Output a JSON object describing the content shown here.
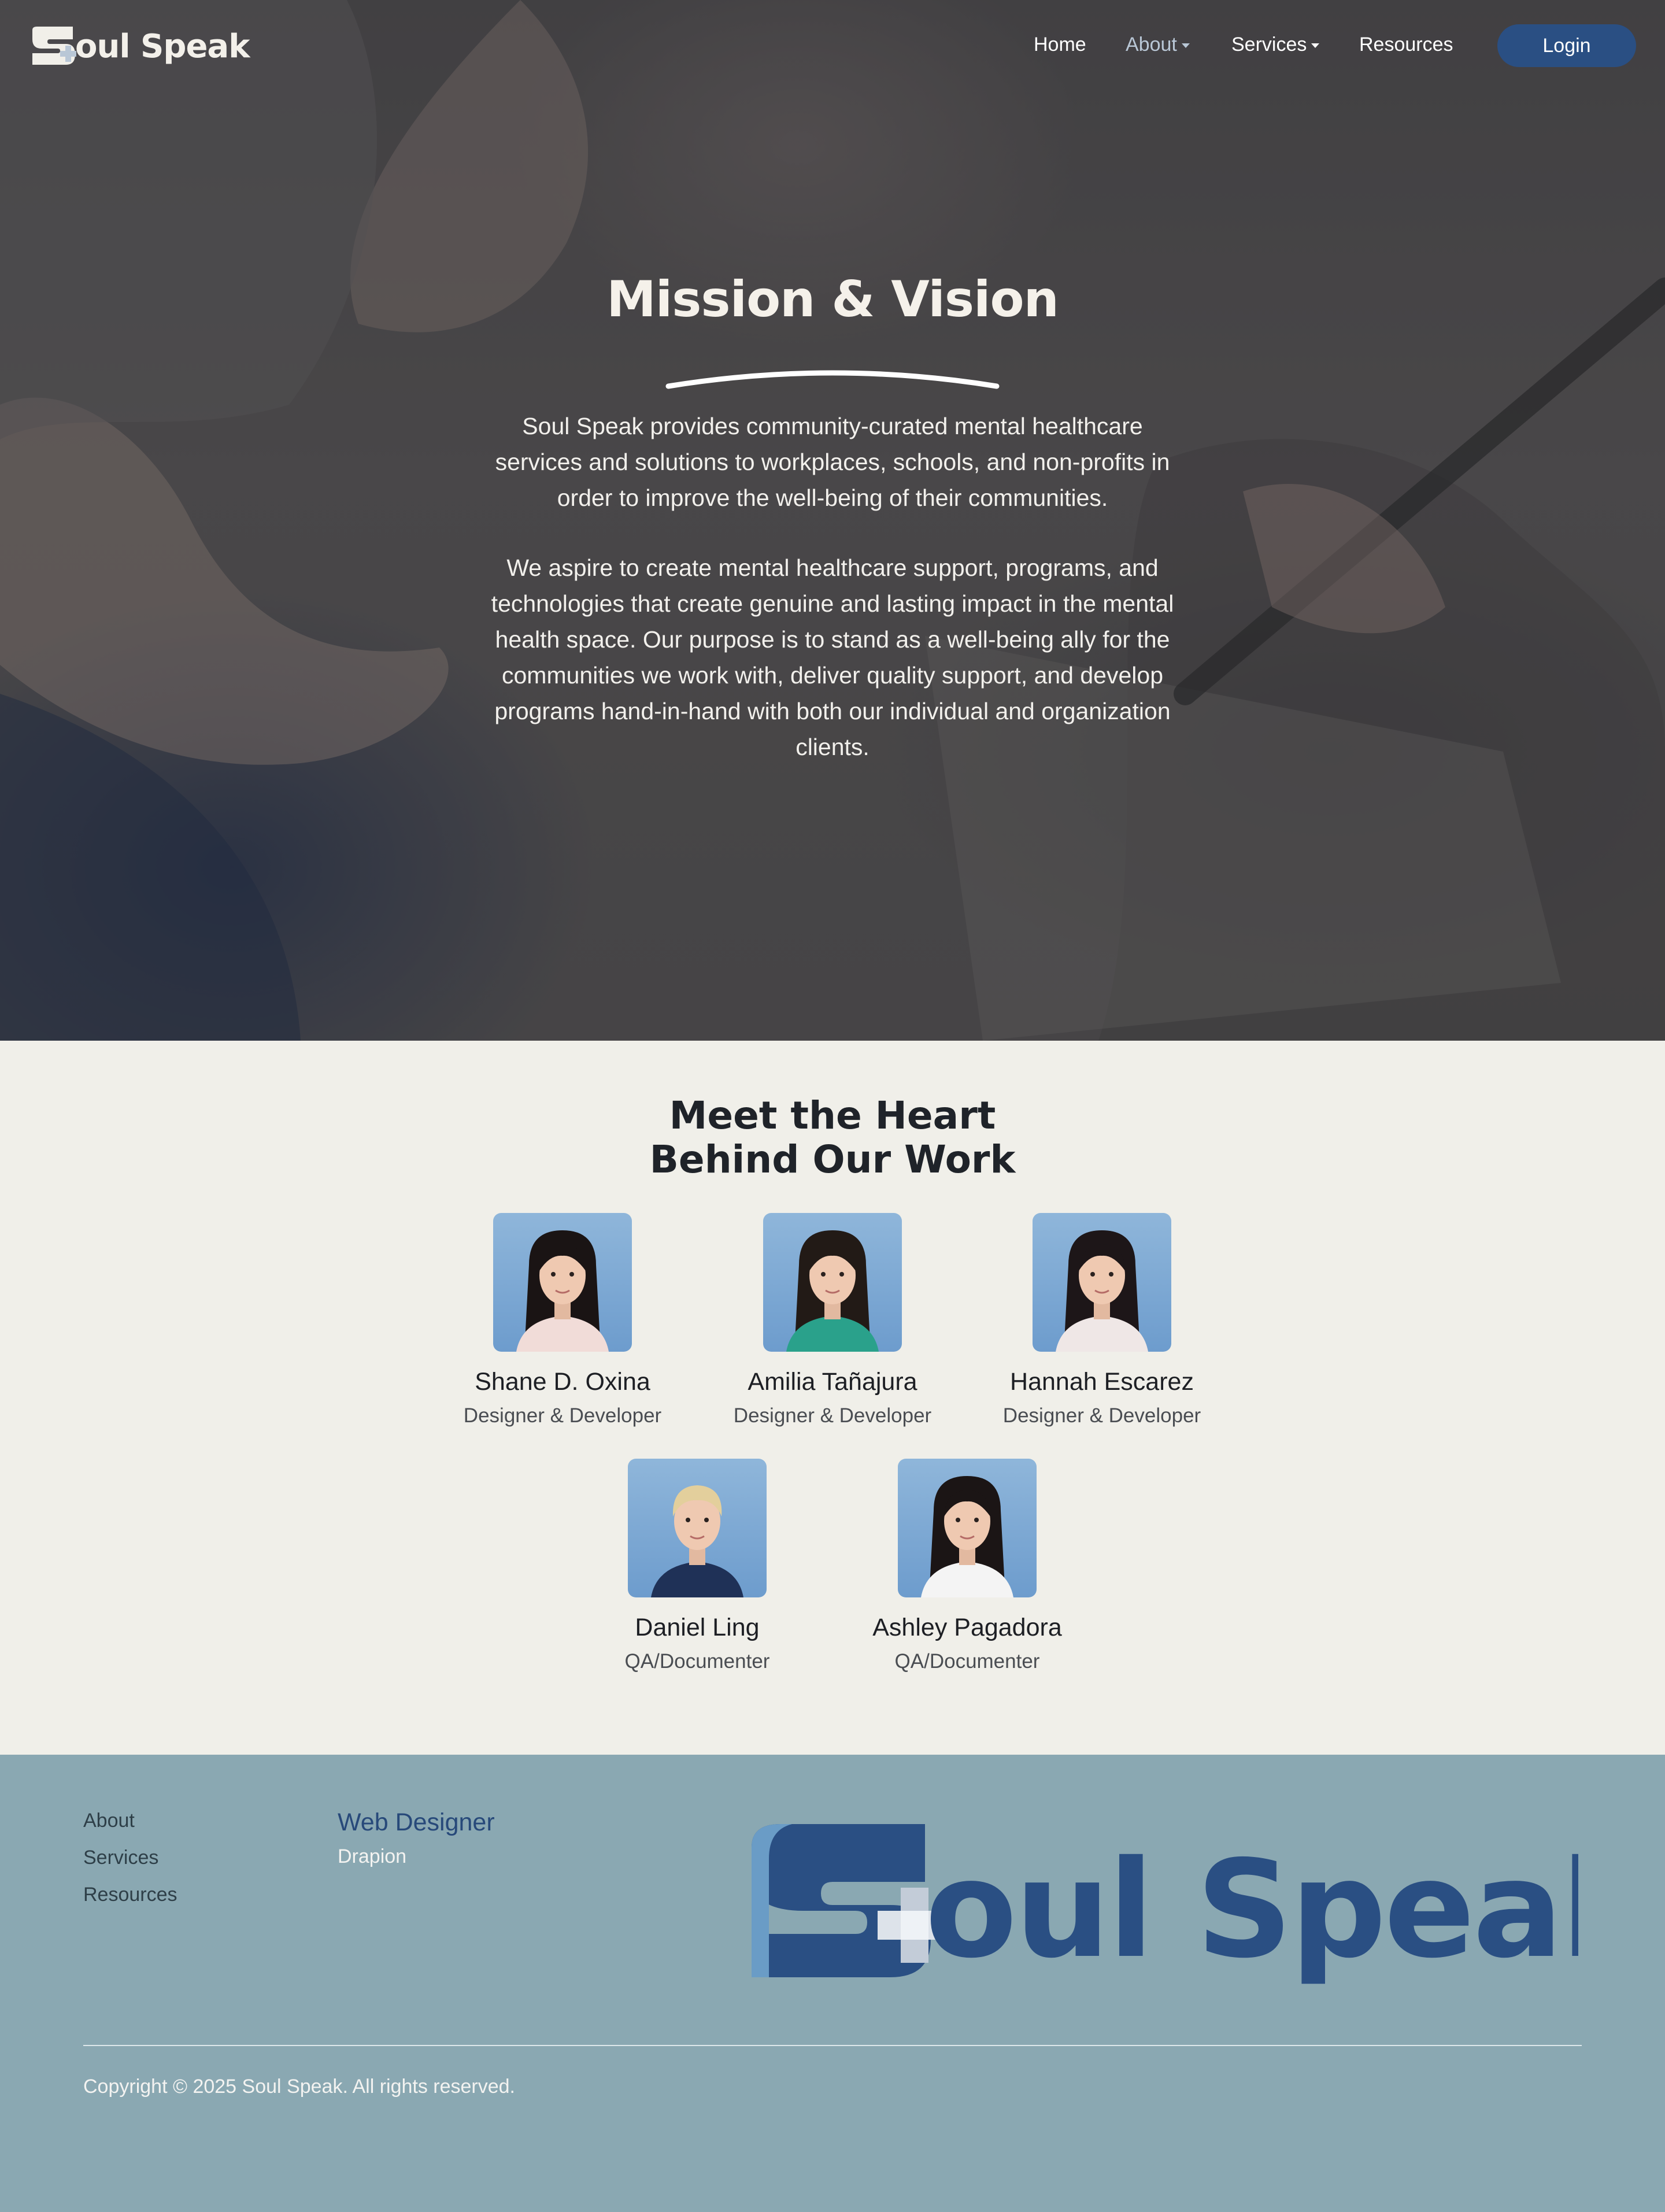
{
  "brand": {
    "name": "Soul Speak",
    "primary_color": "#2a4f83",
    "footer_bg": "#8aa8b2",
    "team_bg": "#f0efe9"
  },
  "nav": {
    "items": [
      {
        "label": "Home",
        "dropdown": false,
        "active": false
      },
      {
        "label": "About",
        "dropdown": true,
        "active": true
      },
      {
        "label": "Services",
        "dropdown": true,
        "active": false
      },
      {
        "label": "Resources",
        "dropdown": false,
        "active": false
      }
    ],
    "login_label": "Login"
  },
  "hero": {
    "title": "Mission & Vision",
    "paragraph1": "Soul Speak provides community-curated mental healthcare services and solutions to workplaces, schools, and non-profits in order to improve the well-being of their communities.",
    "paragraph2": "We aspire to create mental healthcare support, programs, and technologies that create genuine and lasting impact in the mental health space. Our purpose is to stand as a well-being ally for the communities we work with, deliver quality support, and develop programs hand-in-hand with both our individual and organization clients."
  },
  "team": {
    "title_line1": "Meet the Heart",
    "title_line2": "Behind Our Work",
    "members": [
      {
        "name": "Shane D. Oxina",
        "role": "Designer & Developer",
        "shirt": "#f1dcd8",
        "hair": "#1a1414"
      },
      {
        "name": "Amilia Tañajura",
        "role": "Designer & Developer",
        "shirt": "#2aa18b",
        "hair": "#221a16"
      },
      {
        "name": "Hannah Escarez",
        "role": "Designer & Developer",
        "shirt": "#efe7e6",
        "hair": "#1d1618"
      },
      {
        "name": "Daniel Ling",
        "role": "QA/Documenter",
        "shirt": "#1f3157",
        "hair": "#e3cf9c"
      },
      {
        "name": "Ashley Pagadora",
        "role": "QA/Documenter",
        "shirt": "#f4f4f4",
        "hair": "#1b1515"
      }
    ]
  },
  "footer": {
    "links": [
      "About",
      "Services",
      "Resources"
    ],
    "credit_role": "Web Designer",
    "credit_company": "Drapion",
    "logo_text": "oul Speak",
    "copyright": "Copyright © 2025 Soul Speak. All rights reserved."
  }
}
